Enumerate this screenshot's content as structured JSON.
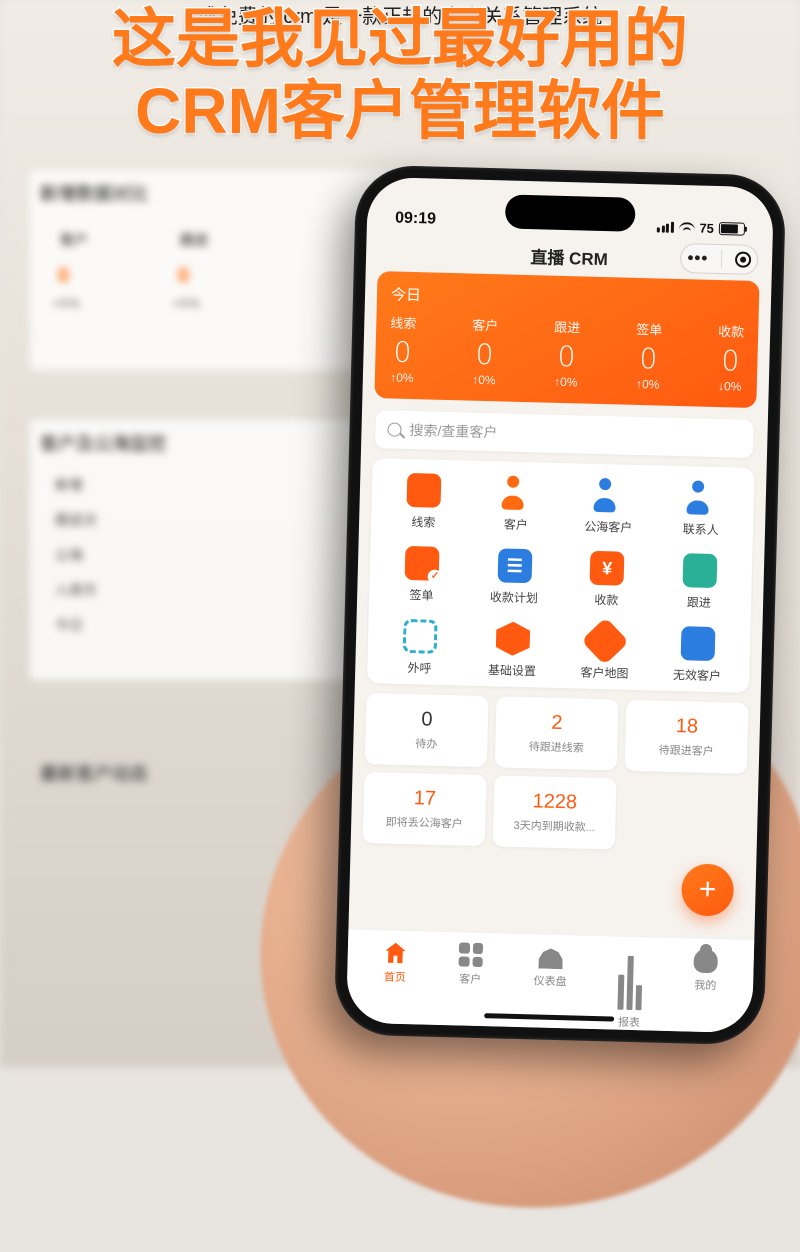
{
  "caption": "成免费的 crm 是一款正规的客户关系管理系统",
  "headline_line1": "这是我见过最好用的",
  "headline_line2": "CRM客户管理软件",
  "bg": {
    "section1_title": "新增数据对比",
    "col1": "客户",
    "col2": "跟进",
    "v1": "0",
    "v2": "0",
    "pct": "+0%",
    "section2_title": "客户及公海监控",
    "rows": [
      "新增",
      "跟进次",
      "公海",
      "入库天",
      "今日"
    ],
    "section3_title": "最新客户动态"
  },
  "status": {
    "time": "09:19",
    "battery": "75"
  },
  "app_title": "直播 CRM",
  "dash": {
    "title": "今日",
    "cells": [
      {
        "label": "线索",
        "value": "0",
        "pct": "↑0%"
      },
      {
        "label": "客户",
        "value": "0",
        "pct": "↑0%"
      },
      {
        "label": "跟进",
        "value": "0",
        "pct": "↑0%"
      },
      {
        "label": "签单",
        "value": "0",
        "pct": "↑0%"
      },
      {
        "label": "收款",
        "value": "0",
        "pct": "↓0%"
      }
    ]
  },
  "search_placeholder": "搜索/查重客户",
  "apps": [
    {
      "label": "线索",
      "icon": "steth"
    },
    {
      "label": "客户",
      "icon": "person-o"
    },
    {
      "label": "公海客户",
      "icon": "person-b"
    },
    {
      "label": "联系人",
      "icon": "person-b"
    },
    {
      "label": "签单",
      "icon": "doc"
    },
    {
      "label": "收款计划",
      "icon": "cal"
    },
    {
      "label": "收款",
      "icon": "yen"
    },
    {
      "label": "跟进",
      "icon": "swirl"
    },
    {
      "label": "外呼",
      "icon": "ring"
    },
    {
      "label": "基础设置",
      "icon": "hex"
    },
    {
      "label": "客户地图",
      "icon": "pin"
    },
    {
      "label": "无效客户",
      "icon": "circ"
    }
  ],
  "cards": [
    {
      "num": "0",
      "label": "待办",
      "cls": "black"
    },
    {
      "num": "2",
      "label": "待跟进线索",
      "cls": "orange"
    },
    {
      "num": "18",
      "label": "待跟进客户",
      "cls": "orange"
    },
    {
      "num": "17",
      "label": "即将丢公海客户",
      "cls": "orange"
    },
    {
      "num": "1228",
      "label": "3天内到期收款...",
      "cls": "orange"
    }
  ],
  "nav": [
    {
      "label": "首页",
      "active": true
    },
    {
      "label": "客户",
      "active": false
    },
    {
      "label": "仪表盘",
      "active": false
    },
    {
      "label": "报表",
      "active": false
    },
    {
      "label": "我的",
      "active": false
    }
  ]
}
